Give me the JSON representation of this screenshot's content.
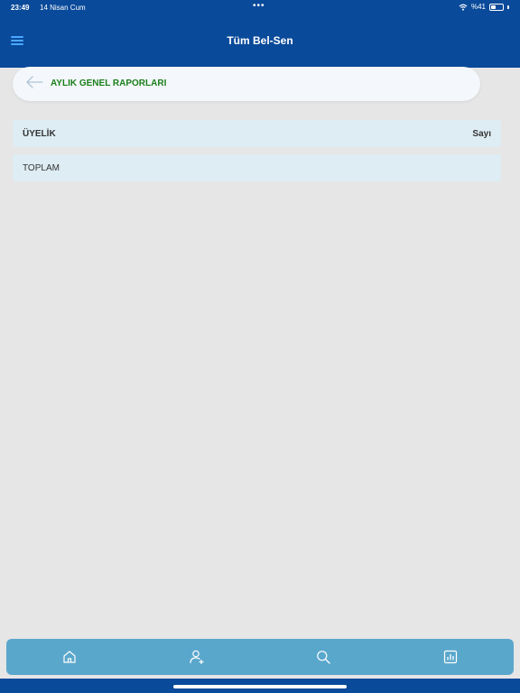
{
  "status": {
    "time": "23:49",
    "date": "14 Nisan Cum",
    "dots": "•••",
    "battery_text": "%41",
    "battery_level": 0.41
  },
  "header": {
    "title": "Tüm Bel-Sen"
  },
  "page": {
    "back_title": "AYLIK GENEL RAPORLARI"
  },
  "table": {
    "header_label": "ÜYELİK",
    "header_value": "Sayı",
    "rows": [
      {
        "label": "TOPLAM",
        "value": ""
      }
    ]
  },
  "tabbar": {
    "tabs": [
      {
        "icon": "home-icon"
      },
      {
        "icon": "add-user-icon"
      },
      {
        "icon": "search-icon"
      },
      {
        "icon": "chart-icon"
      }
    ]
  },
  "colors": {
    "primary": "#0a4a9a",
    "accent_green": "#1a7f1a",
    "tabbar": "#5aa7cc",
    "row_bg": "#deedf4",
    "background": "#e6e6e6"
  }
}
